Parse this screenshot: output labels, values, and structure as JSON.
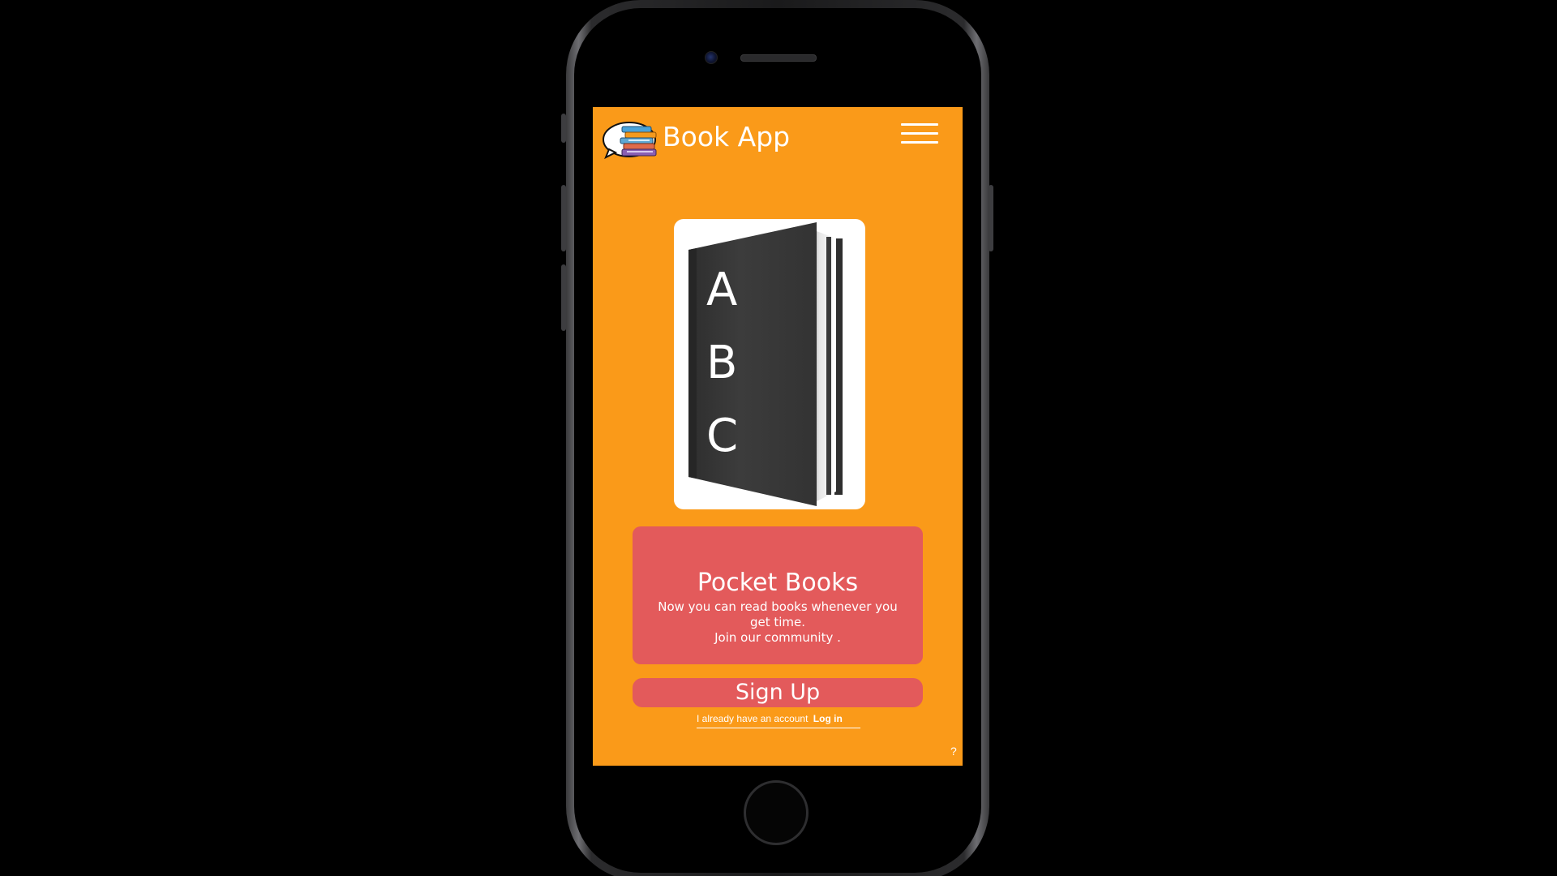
{
  "app": {
    "title": "Book App",
    "menu_icon": "hamburger-menu-icon",
    "logo_icon": "stacked-books-logo"
  },
  "hero": {
    "image": "abc-book-illustration",
    "letters": [
      "A",
      "B",
      "C"
    ]
  },
  "promo": {
    "title": "Pocket Books",
    "lines": [
      "Now you can read books whenever you",
      "get time.",
      "Join our community ."
    ]
  },
  "actions": {
    "signup_label": "Sign Up",
    "account_text": "I already have an account",
    "login_label": "Log in",
    "help_label": "?"
  },
  "colors": {
    "screen_bg": "#fa9a19",
    "card": "#e35a5b",
    "text": "#ffffff",
    "book": "#3a3a3a"
  }
}
